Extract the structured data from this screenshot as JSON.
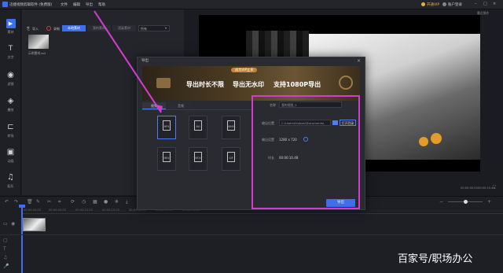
{
  "titlebar": {
    "app_name": "迅捷视频剪辑软件 (免费版)",
    "menu": [
      "文件",
      "编辑",
      "导出",
      "帮助"
    ],
    "vip": "开通VIP",
    "user": "账户登录"
  },
  "left_nav": [
    {
      "label": "素材",
      "icon": "play-icon"
    },
    {
      "label": "文字",
      "icon": "text-icon"
    },
    {
      "label": "滤镜",
      "icon": "filter-icon"
    },
    {
      "label": "叠附",
      "icon": "layers-icon"
    },
    {
      "label": "转场",
      "icon": "transition-icon"
    },
    {
      "label": "动画",
      "icon": "animation-icon"
    },
    {
      "label": "配乐",
      "icon": "music-icon"
    }
  ],
  "media": {
    "tabs": [
      "本地素材",
      "我的素材",
      "渲染素材"
    ],
    "filter": "所有",
    "import_label": "导入",
    "record_label": "录制",
    "file_name": "示例素材.avi"
  },
  "preview": {
    "top_right": "最近操作",
    "time_a": "00:00:00.00",
    "time_b": "00:00:10.48"
  },
  "timeline": {
    "ticks": [
      "00:00:00.00",
      "00:00:05.00",
      "00:00:10.00",
      "00:00:15.00",
      "00:00:20.00",
      "00:00:25.00",
      "00:00:30.00"
    ]
  },
  "dialog": {
    "title": "导出",
    "banner": {
      "badge": "成为VIP立享",
      "text1": "导出时长不限",
      "text2": "导出无水印",
      "text3": "支持1080P导出"
    },
    "tabs": [
      "视频",
      "音频"
    ],
    "formats": [
      "MP4",
      "AVI",
      "WMV",
      "MKV",
      "MOV",
      "GIF"
    ],
    "fields": {
      "name_label": "名称",
      "name_value": "我的视频_2",
      "path_label": "输出位置",
      "path_value": "C:\\Users\\fxuban\\Documents\\",
      "open_dir": "打开目录",
      "settings_label": "输出设置",
      "resolution": "1280 x 720",
      "duration_label": "时长",
      "duration_value": "00:00:10.48"
    },
    "export_button": "导出"
  },
  "watermark": "百家号/职场办公",
  "colors": {
    "accent": "#3d6ef0",
    "highlight": "#d43ccf"
  }
}
